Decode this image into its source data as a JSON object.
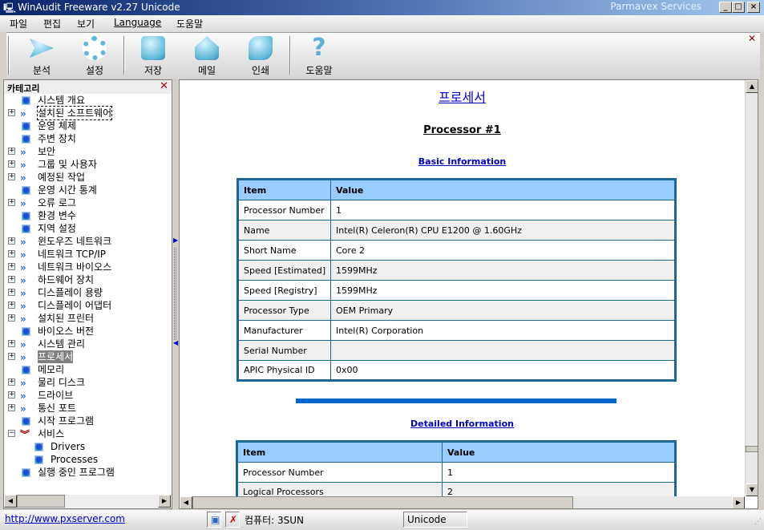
{
  "window": {
    "title": "WinAudit Freeware v2.27 Unicode",
    "vendor": "Parmavex Services"
  },
  "menu": [
    "파일",
    "편집",
    "보기",
    "Language",
    "도움말"
  ],
  "toolbar": [
    {
      "label": "분석",
      "icon": "play-icon"
    },
    {
      "label": "설정",
      "icon": "gear-icon"
    },
    {
      "label": "저장",
      "icon": "save-icon"
    },
    {
      "label": "메일",
      "icon": "mail-icon"
    },
    {
      "label": "인쇄",
      "icon": "print-icon"
    },
    {
      "label": "도움말",
      "icon": "help-icon"
    }
  ],
  "sidebar": {
    "title": "카테고리",
    "items": [
      {
        "label": "시스템 개요",
        "type": "leaf"
      },
      {
        "label": "설치된 소프트웨어",
        "type": "collapsed",
        "focused": true
      },
      {
        "label": "운영 체제",
        "type": "leaf"
      },
      {
        "label": "주변 장치",
        "type": "leaf"
      },
      {
        "label": "보안",
        "type": "collapsed"
      },
      {
        "label": "그룹 및 사용자",
        "type": "collapsed"
      },
      {
        "label": "예정된 작업",
        "type": "collapsed"
      },
      {
        "label": "운영 시간 통계",
        "type": "leaf"
      },
      {
        "label": "오류 로그",
        "type": "collapsed"
      },
      {
        "label": "환경 변수",
        "type": "leaf"
      },
      {
        "label": "지역 설정",
        "type": "leaf"
      },
      {
        "label": "윈도우즈 네트워크",
        "type": "collapsed"
      },
      {
        "label": "네트워크 TCP/IP",
        "type": "collapsed"
      },
      {
        "label": "네트워크 바이오스",
        "type": "collapsed"
      },
      {
        "label": "하드웨어 장치",
        "type": "collapsed"
      },
      {
        "label": "디스플레이 용량",
        "type": "collapsed"
      },
      {
        "label": "디스플레이 어댑터",
        "type": "collapsed"
      },
      {
        "label": "설치된 프린터",
        "type": "collapsed"
      },
      {
        "label": "바이오스 버전",
        "type": "leaf"
      },
      {
        "label": "시스템 관리",
        "type": "collapsed"
      },
      {
        "label": "프로세서",
        "type": "collapsed",
        "selected": true
      },
      {
        "label": "메모리",
        "type": "leaf"
      },
      {
        "label": "물리 디스크",
        "type": "collapsed"
      },
      {
        "label": "드라이브",
        "type": "collapsed"
      },
      {
        "label": "통신 포트",
        "type": "collapsed"
      },
      {
        "label": "시작 프로그램",
        "type": "leaf"
      },
      {
        "label": "서비스",
        "type": "expanded"
      },
      {
        "label": "Drivers",
        "type": "child"
      },
      {
        "label": "Processes",
        "type": "child"
      },
      {
        "label": "실행 중인 프로그램",
        "type": "leaf"
      }
    ]
  },
  "content": {
    "title": "프로세서",
    "subtitle": "Processor #1",
    "basic": {
      "heading": "Basic Information",
      "columns": [
        "Item",
        "Value"
      ],
      "rows": [
        [
          "Processor Number",
          "1"
        ],
        [
          "Name",
          "Intel(R) Celeron(R) CPU E1200 @ 1.60GHz"
        ],
        [
          "Short Name",
          "Core 2"
        ],
        [
          "Speed [Estimated]",
          "1599MHz"
        ],
        [
          "Speed [Registry]",
          "1599MHz"
        ],
        [
          "Processor Type",
          "OEM Primary"
        ],
        [
          "Manufacturer",
          "Intel(R) Corporation"
        ],
        [
          "Serial Number",
          ""
        ],
        [
          "APIC Physical ID",
          "0x00"
        ]
      ]
    },
    "detailed": {
      "heading": "Detailed Information",
      "columns": [
        "Item",
        "Value"
      ],
      "rows": [
        [
          "Processor Number",
          "1"
        ],
        [
          "Logical Processors",
          "2"
        ]
      ]
    }
  },
  "status": {
    "link": "http://www.pxserver.com",
    "computer": "컴퓨터: 3SUN",
    "encoding": "Unicode"
  },
  "colors": {
    "accent": "#1a6890",
    "header": "#99ccff",
    "divider": "#0066cc"
  }
}
